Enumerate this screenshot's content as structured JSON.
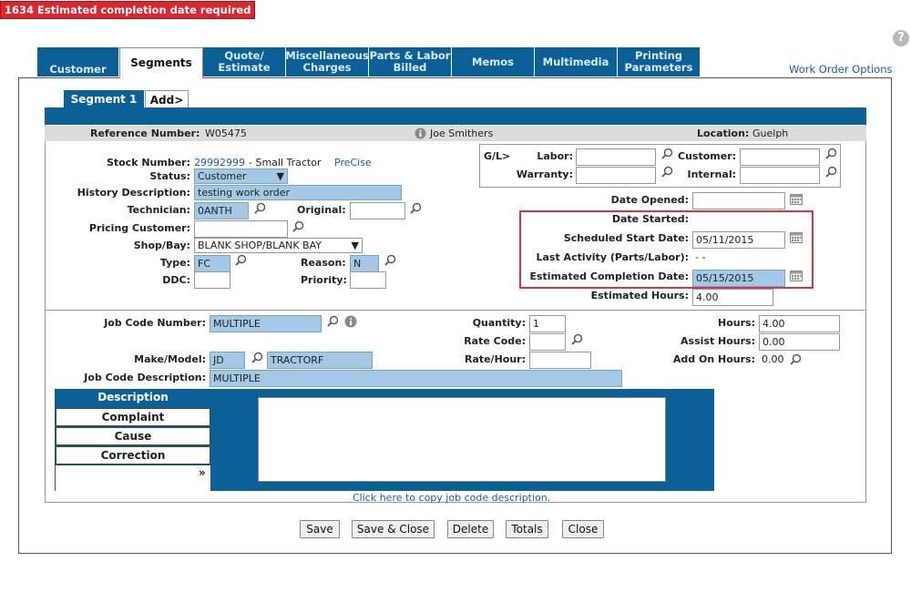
{
  "error_banner": "1634 Estimated completion date required",
  "help_label": "?",
  "tabs": [
    {
      "label": "Customer"
    },
    {
      "label": "Segments"
    },
    {
      "label": "Quote/\nEstimate"
    },
    {
      "label": "Miscellaneous\nCharges"
    },
    {
      "label": "Parts & Labor\nBilled"
    },
    {
      "label": "Memos"
    },
    {
      "label": "Multimedia"
    },
    {
      "label": "Printing\nParameters"
    }
  ],
  "work_order_options": "Work Order Options",
  "segment_tabs": {
    "segment1": "Segment 1",
    "add": "Add>"
  },
  "header": {
    "reference_label": "Reference Number:",
    "reference_value": "W05475",
    "person": "Joe Smithers",
    "location_label": "Location:",
    "location_value": "Guelph"
  },
  "form": {
    "stock_label": "Stock Number:",
    "stock_value": "29992999",
    "stock_desc": "- Small Tractor",
    "stock_link": "PreCise",
    "status_label": "Status:",
    "status_value": "Customer",
    "history_label": "History Description:",
    "history_value": "testing work order",
    "technician_label": "Technician:",
    "technician_value": "0ANTH",
    "original_label": "Original:",
    "original_value": "",
    "pricing_label": "Pricing Customer:",
    "pricing_value": "",
    "shop_label": "Shop/Bay:",
    "shop_value": "BLANK SHOP/BLANK BAY",
    "type_label": "Type:",
    "type_value": "FC",
    "reason_label": "Reason:",
    "reason_value": "N",
    "ddc_label": "DDC:",
    "ddc_value": "",
    "priority_label": "Priority:",
    "priority_value": ""
  },
  "gl": {
    "gl_label": "G/L>",
    "labor_label": "Labor:",
    "labor_value": "",
    "customer_label": "Customer:",
    "customer_value": "",
    "warranty_label": "Warranty:",
    "warranty_value": "",
    "internal_label": "Internal:",
    "internal_value": ""
  },
  "dates": {
    "opened_label": "Date Opened:",
    "opened_value": "",
    "started_label": "Date Started:",
    "scheduled_label": "Scheduled Start Date:",
    "scheduled_value": "05/11/2015",
    "last_activity_label": "Last Activity (Parts/Labor):",
    "last_activity_value": "- -",
    "est_completion_label": "Estimated Completion Date:",
    "est_completion_value": "05/15/2015",
    "est_hours_label": "Estimated Hours:",
    "est_hours_value": "4.00"
  },
  "job": {
    "job_code_label": "Job Code Number:",
    "job_code_value": "MULTIPLE",
    "quantity_label": "Quantity:",
    "quantity_value": "1",
    "hours_label": "Hours:",
    "hours_value": "4.00",
    "rate_code_label": "Rate Code:",
    "rate_code_value": "",
    "assist_label": "Assist Hours:",
    "assist_value": "0.00",
    "make_label": "Make/Model:",
    "make_value": "JD",
    "model_value": "TRACTORF",
    "rate_hour_label": "Rate/Hour:",
    "rate_hour_value": "",
    "addon_label": "Add On Hours:",
    "addon_value": "0.00",
    "job_desc_label": "Job Code Description:",
    "job_desc_value": "MULTIPLE"
  },
  "description_panel": {
    "header": "Description",
    "complaint": "Complaint",
    "cause": "Cause",
    "correction": "Correction",
    "expand": "»"
  },
  "copy_link": "Click here to copy job code description.",
  "buttons": {
    "save": "Save",
    "save_close": "Save & Close",
    "delete": "Delete",
    "totals": "Totals",
    "close": "Close"
  }
}
